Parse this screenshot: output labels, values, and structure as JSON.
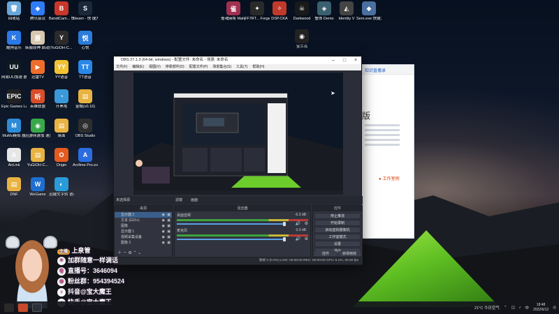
{
  "desktop": {
    "left_icons": [
      {
        "label": "回收站",
        "color": "#6aa7d9",
        "glyph": "🗑"
      },
      {
        "label": "腾讯会议",
        "color": "#2f7cf6",
        "glyph": "◆"
      },
      {
        "label": "BandiCam...\n快捷方式",
        "color": "#c9362a",
        "glyph": "B"
      },
      {
        "label": "Steam - 快\n捷方式",
        "color": "#1b2838",
        "glyph": "S"
      },
      {
        "label": "酷狗音乐",
        "color": "#2a79e6",
        "glyph": "K"
      },
      {
        "label": "韩服原神\n启动器",
        "color": "#d7c7b0",
        "glyph": "原"
      },
      {
        "label": "YuGiOH-C...",
        "color": "#2b2b2b",
        "glyph": "Y"
      },
      {
        "label": "心悦",
        "color": "#2b7bd9",
        "glyph": "悦"
      },
      {
        "label": "网易UU加速\n器",
        "color": "#101820",
        "glyph": "UU"
      },
      {
        "label": "迅雷TV",
        "color": "#ef6d2b",
        "glyph": "▶"
      },
      {
        "label": "YY语音",
        "color": "#f1c232",
        "glyph": "YY"
      },
      {
        "label": "TT语音",
        "color": "#2a87e6",
        "glyph": "TT"
      },
      {
        "label": "Epic Games\nLauncher",
        "color": "#222222",
        "glyph": "EPIC"
      },
      {
        "label": "英雄联盟",
        "color": "#d94e2a",
        "glyph": "听"
      },
      {
        "label": "开黑啦",
        "color": "#3a9ad9",
        "glyph": "◔"
      },
      {
        "label": "金蝶(v0.16)",
        "color": "#e8b342",
        "glyph": "▤"
      },
      {
        "label": "MuMu模拟\n器",
        "color": "#2d8bd8",
        "glyph": "M"
      },
      {
        "label": "迅游网游加\n速器",
        "color": "#39a84a",
        "glyph": "◉"
      },
      {
        "label": "桌面",
        "color": "#e8b342",
        "glyph": "▤"
      },
      {
        "label": "OBS Studio",
        "color": "#2e2e2e",
        "glyph": "◎"
      },
      {
        "label": "AirLink",
        "color": "#e6e6e6",
        "glyph": "A"
      },
      {
        "label": "YuGiOH-C...",
        "color": "#e8b342",
        "glyph": "▤"
      },
      {
        "label": "Origin",
        "color": "#e55a1f",
        "glyph": "O"
      },
      {
        "label": "Arcfime\nPro.exe",
        "color": "#2b6de0",
        "glyph": "A"
      },
      {
        "label": "DNF",
        "color": "#e8b342",
        "glyph": "▤"
      },
      {
        "label": "WeGame",
        "color": "#1f6fd0",
        "glyph": "W"
      },
      {
        "label": "迅捷文字转\n语音",
        "color": "#2a9ad9",
        "glyph": "◐"
      }
    ],
    "top_icons": [
      {
        "label": "雀魂麻将\nMahjong...",
        "color": "#a03050",
        "glyph": "雀"
      },
      {
        "label": "FF7RT...\nForged...",
        "color": "#2a2a2a",
        "glyph": "✦"
      },
      {
        "label": "DSP.CKA",
        "color": "#c0392b",
        "glyph": "✧"
      },
      {
        "label": "Darkwood",
        "color": "#1a1a1a",
        "glyph": "☠"
      },
      {
        "label": "蟹体 Demo",
        "color": "#3a5f6f",
        "glyph": "◈"
      },
      {
        "label": "Identity V",
        "color": "#444444",
        "glyph": "◭"
      },
      {
        "label": "Sero.exe\n快捷方式",
        "color": "#4a6fa0",
        "glyph": "◆"
      },
      {
        "label": "宝兰克",
        "color": "#222222",
        "glyph": "◉"
      }
    ]
  },
  "browser": {
    "tab_text": "知识直播录",
    "heading": "版",
    "radio_label": "工作室例"
  },
  "obs": {
    "title": "OBS 27.1.3 (64-bit, windows) - 配置文件: 未命名 - 场景: 未命名",
    "menu": [
      "文件(F)",
      "编辑(E)",
      "视图(V)",
      "停靠部件(D)",
      "配置文件(P)",
      "场景集合(S)",
      "工具(T)",
      "帮助(H)"
    ],
    "scene_bar_tabs": [
      "滤镜",
      "画面"
    ],
    "scene_label": "未选择源",
    "docks": {
      "sources_header": "来源",
      "mixer_header": "混音器",
      "controls_header": "控件"
    },
    "sources": [
      {
        "name": "显示器 2",
        "selected": true
      },
      {
        "name": "文本 (GDI+)",
        "selected": false
      },
      {
        "name": "图像",
        "selected": false
      },
      {
        "name": "显示器 1",
        "selected": false
      },
      {
        "name": "视频采集设备",
        "selected": false
      },
      {
        "name": "图像 2",
        "selected": false
      }
    ],
    "mixer": [
      {
        "name": "桌面音频",
        "db": "-6.3 dB"
      },
      {
        "name": "麦克风",
        "db": "0.0 dB"
      }
    ],
    "controls": [
      "停止推流",
      "开始录制",
      "启动虚拟摄像机",
      "工作室模式",
      "设置",
      "退出"
    ],
    "controls_bottom": [
      "控件",
      "转场特效"
    ],
    "status": "丢帧 0 (0.0%)    LIVE: 00:00:00    REC: 00:00:00    CPU: 5.1%, 30.00 fps"
  },
  "overlay": {
    "streamer_tag": "主播",
    "streamer_name": "上泉管",
    "lines": [
      {
        "icon": "♥",
        "text": "加群随意一样调话"
      },
      {
        "icon": "Q",
        "text": "直播号：3646094"
      },
      {
        "icon": "◉",
        "text": "粉丝群：954394524"
      },
      {
        "icon": "♪",
        "text": "抖音@宝大魔王"
      },
      {
        "icon": "♪",
        "text": "快手@宝大魔王"
      }
    ]
  },
  "taskbar": {
    "weather": "21°C 今日空气",
    "time": "18:48",
    "date": "2022/6/12",
    "notif_icon": "◎"
  }
}
